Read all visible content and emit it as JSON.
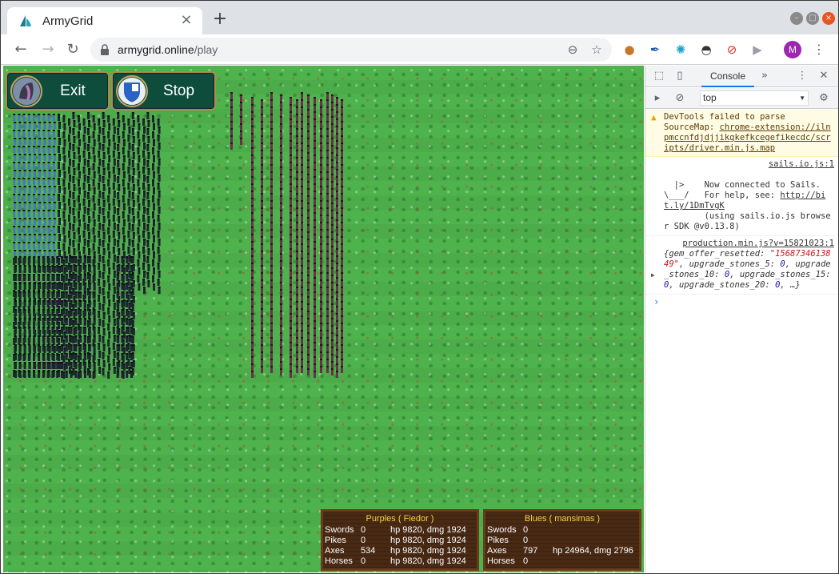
{
  "browser": {
    "tab_title": "ArmyGrid",
    "url_domain": "armygrid.online",
    "url_path": "/play",
    "avatar_letter": "M"
  },
  "game": {
    "buttons": [
      {
        "label": "Exit"
      },
      {
        "label": "Stop"
      }
    ],
    "panels": [
      {
        "title": "Purples ( Fiedor )",
        "rows": [
          {
            "unit": "Swords",
            "count": "0",
            "stats": "hp 9820, dmg 1924"
          },
          {
            "unit": "Pikes",
            "count": "0",
            "stats": "hp 9820, dmg 1924"
          },
          {
            "unit": "Axes",
            "count": "534",
            "stats": "hp 9820, dmg 1924"
          },
          {
            "unit": "Horses",
            "count": "0",
            "stats": "hp 9820, dmg 1924"
          }
        ]
      },
      {
        "title": "Blues ( mansimas )",
        "rows": [
          {
            "unit": "Swords",
            "count": "0",
            "stats": ""
          },
          {
            "unit": "Pikes",
            "count": "0",
            "stats": ""
          },
          {
            "unit": "Axes",
            "count": "797",
            "stats": "hp 24964, dmg 2796"
          },
          {
            "unit": "Horses",
            "count": "0",
            "stats": ""
          }
        ]
      }
    ]
  },
  "devtools": {
    "tab_label": "Console",
    "context": "top",
    "messages": {
      "warn_text": "DevTools failed to parse SourceMap: ",
      "warn_link": "chrome-extension://ilnpmccnfdjdjjikgkefkcegefikecdc/scripts/driver.min.js.map",
      "sails_src": "sails.io.js:1",
      "sails_text_1": "  |>    Now connected to Sails.",
      "sails_text_2": "\\___/   For help, see: ",
      "sails_link": "http://bit.ly/1DmTvgK",
      "sails_text_3": "        (using sails.io.js browser SDK @v0.13.8)",
      "prod_src": "production.min.js?v=15821023:1",
      "obj_open": "{gem_offer_resetted: ",
      "obj_str": "\"1568734613849\"",
      "obj_mid1": ", upgrade_stones_5: ",
      "obj_v1": "0",
      "obj_mid2": ", upgrade_stones_10: ",
      "obj_v2": "0",
      "obj_mid3": ", upgrade_stones_15: ",
      "obj_v3": "0",
      "obj_mid4": ", upgrade_stones_20: ",
      "obj_v4": "0",
      "obj_close": ", …}",
      "prompt": "›"
    }
  }
}
